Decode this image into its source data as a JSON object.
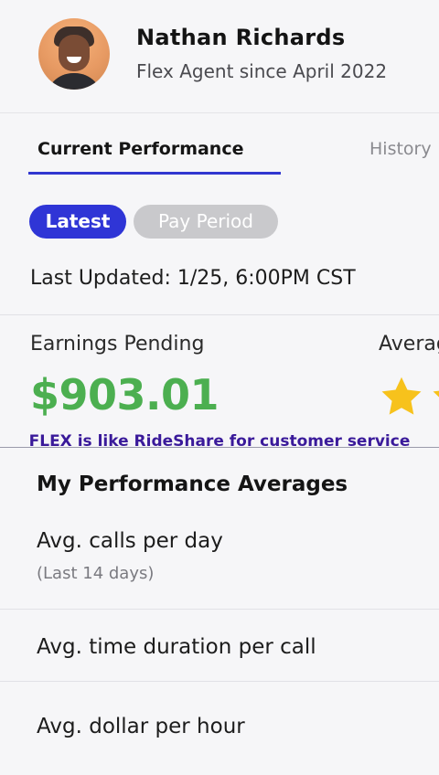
{
  "profile": {
    "name": "Nathan Richards",
    "subtitle": "Flex Agent since April 2022"
  },
  "tabs": {
    "current": "Current Performance",
    "history": "History"
  },
  "filters": {
    "latest": "Latest",
    "pay_period": "Pay Period"
  },
  "last_updated": "Last Updated: 1/25, 6:00PM CST",
  "earnings": {
    "label": "Earnings Pending",
    "value": "$903.01"
  },
  "rating": {
    "label": "Average Rating"
  },
  "caption": "FLEX is like RideShare for customer service",
  "averages": {
    "title": "My Performance Averages",
    "items": [
      {
        "label": "Avg. calls per day",
        "sub": "(Last 14 days)"
      },
      {
        "label": "Avg. time duration per call"
      },
      {
        "label": "Avg. dollar per hour"
      }
    ]
  },
  "colors": {
    "accent": "#2f35d6",
    "earnings": "#4caf50",
    "star": "#f7c21c",
    "caption": "#3a1a9a"
  }
}
